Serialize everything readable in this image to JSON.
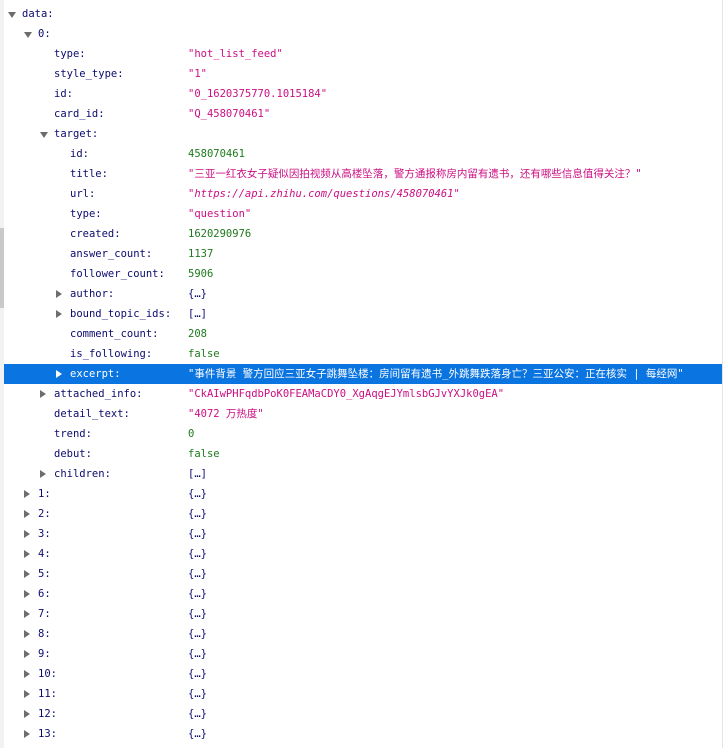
{
  "rows": [
    {
      "key": "data:",
      "val": "",
      "kind": "none",
      "depth": 0,
      "toggle": "open"
    },
    {
      "key": "0:",
      "val": "",
      "kind": "none",
      "depth": 1,
      "toggle": "open"
    },
    {
      "key": "type:",
      "val": "\"hot_list_feed\"",
      "kind": "str",
      "depth": 2,
      "toggle": "none"
    },
    {
      "key": "style_type:",
      "val": "\"1\"",
      "kind": "str",
      "depth": 2,
      "toggle": "none"
    },
    {
      "key": "id:",
      "val": "\"0_1620375770.1015184\"",
      "kind": "str",
      "depth": 2,
      "toggle": "none"
    },
    {
      "key": "card_id:",
      "val": "\"Q_458070461\"",
      "kind": "str",
      "depth": 2,
      "toggle": "none"
    },
    {
      "key": "target:",
      "val": "",
      "kind": "none",
      "depth": 2,
      "toggle": "open"
    },
    {
      "key": "id:",
      "val": "458070461",
      "kind": "num",
      "depth": 3,
      "toggle": "none"
    },
    {
      "key": "title:",
      "val": "\"三亚一红衣女子疑似因拍视频从高楼坠落，警方通报称房内留有遗书，还有哪些信息值得关注？\"",
      "kind": "str",
      "depth": 3,
      "toggle": "none"
    },
    {
      "key": "url:",
      "val": "\"https://api.zhihu.com/questions/458070461\"",
      "kind": "str",
      "depth": 3,
      "toggle": "none",
      "italic": true
    },
    {
      "key": "type:",
      "val": "\"question\"",
      "kind": "str",
      "depth": 3,
      "toggle": "none"
    },
    {
      "key": "created:",
      "val": "1620290976",
      "kind": "num",
      "depth": 3,
      "toggle": "none"
    },
    {
      "key": "answer_count:",
      "val": "1137",
      "kind": "num",
      "depth": 3,
      "toggle": "none"
    },
    {
      "key": "follower_count:",
      "val": "5906",
      "kind": "num",
      "depth": 3,
      "toggle": "none"
    },
    {
      "key": "author:",
      "val": "{…}",
      "kind": "obj",
      "depth": 3,
      "toggle": "closed"
    },
    {
      "key": "bound_topic_ids:",
      "val": "[…]",
      "kind": "obj",
      "depth": 3,
      "toggle": "closed"
    },
    {
      "key": "comment_count:",
      "val": "208",
      "kind": "num",
      "depth": 3,
      "toggle": "none"
    },
    {
      "key": "is_following:",
      "val": "false",
      "kind": "bool",
      "depth": 3,
      "toggle": "none"
    },
    {
      "key": "excerpt:",
      "val": "\"事件背景 警方回应三亚女子跳舞坠楼：房间留有遗书_外跳舞跌落身亡？三亚公安：正在核实 | 每经网\"",
      "kind": "str",
      "depth": 3,
      "toggle": "closed",
      "selected": true
    },
    {
      "key": "attached_info:",
      "val": "\"CkAIwPHFqdbPoK0FEAMaCDY0_XgAqgEJYmlsbGJvYXJk0gEA\"",
      "kind": "str",
      "depth": 2,
      "toggle": "closed"
    },
    {
      "key": "detail_text:",
      "val": "\"4072 万热度\"",
      "kind": "str",
      "depth": 2,
      "toggle": "none"
    },
    {
      "key": "trend:",
      "val": "0",
      "kind": "num",
      "depth": 2,
      "toggle": "none"
    },
    {
      "key": "debut:",
      "val": "false",
      "kind": "bool",
      "depth": 2,
      "toggle": "none"
    },
    {
      "key": "children:",
      "val": "[…]",
      "kind": "obj",
      "depth": 2,
      "toggle": "closed"
    },
    {
      "key": "1:",
      "val": "{…}",
      "kind": "obj",
      "depth": 1,
      "toggle": "closed"
    },
    {
      "key": "2:",
      "val": "{…}",
      "kind": "obj",
      "depth": 1,
      "toggle": "closed"
    },
    {
      "key": "3:",
      "val": "{…}",
      "kind": "obj",
      "depth": 1,
      "toggle": "closed"
    },
    {
      "key": "4:",
      "val": "{…}",
      "kind": "obj",
      "depth": 1,
      "toggle": "closed"
    },
    {
      "key": "5:",
      "val": "{…}",
      "kind": "obj",
      "depth": 1,
      "toggle": "closed"
    },
    {
      "key": "6:",
      "val": "{…}",
      "kind": "obj",
      "depth": 1,
      "toggle": "closed"
    },
    {
      "key": "7:",
      "val": "{…}",
      "kind": "obj",
      "depth": 1,
      "toggle": "closed"
    },
    {
      "key": "8:",
      "val": "{…}",
      "kind": "obj",
      "depth": 1,
      "toggle": "closed"
    },
    {
      "key": "9:",
      "val": "{…}",
      "kind": "obj",
      "depth": 1,
      "toggle": "closed"
    },
    {
      "key": "10:",
      "val": "{…}",
      "kind": "obj",
      "depth": 1,
      "toggle": "closed"
    },
    {
      "key": "11:",
      "val": "{…}",
      "kind": "obj",
      "depth": 1,
      "toggle": "closed"
    },
    {
      "key": "12:",
      "val": "{…}",
      "kind": "obj",
      "depth": 1,
      "toggle": "closed"
    },
    {
      "key": "13:",
      "val": "{…}",
      "kind": "obj",
      "depth": 1,
      "toggle": "closed"
    }
  ]
}
